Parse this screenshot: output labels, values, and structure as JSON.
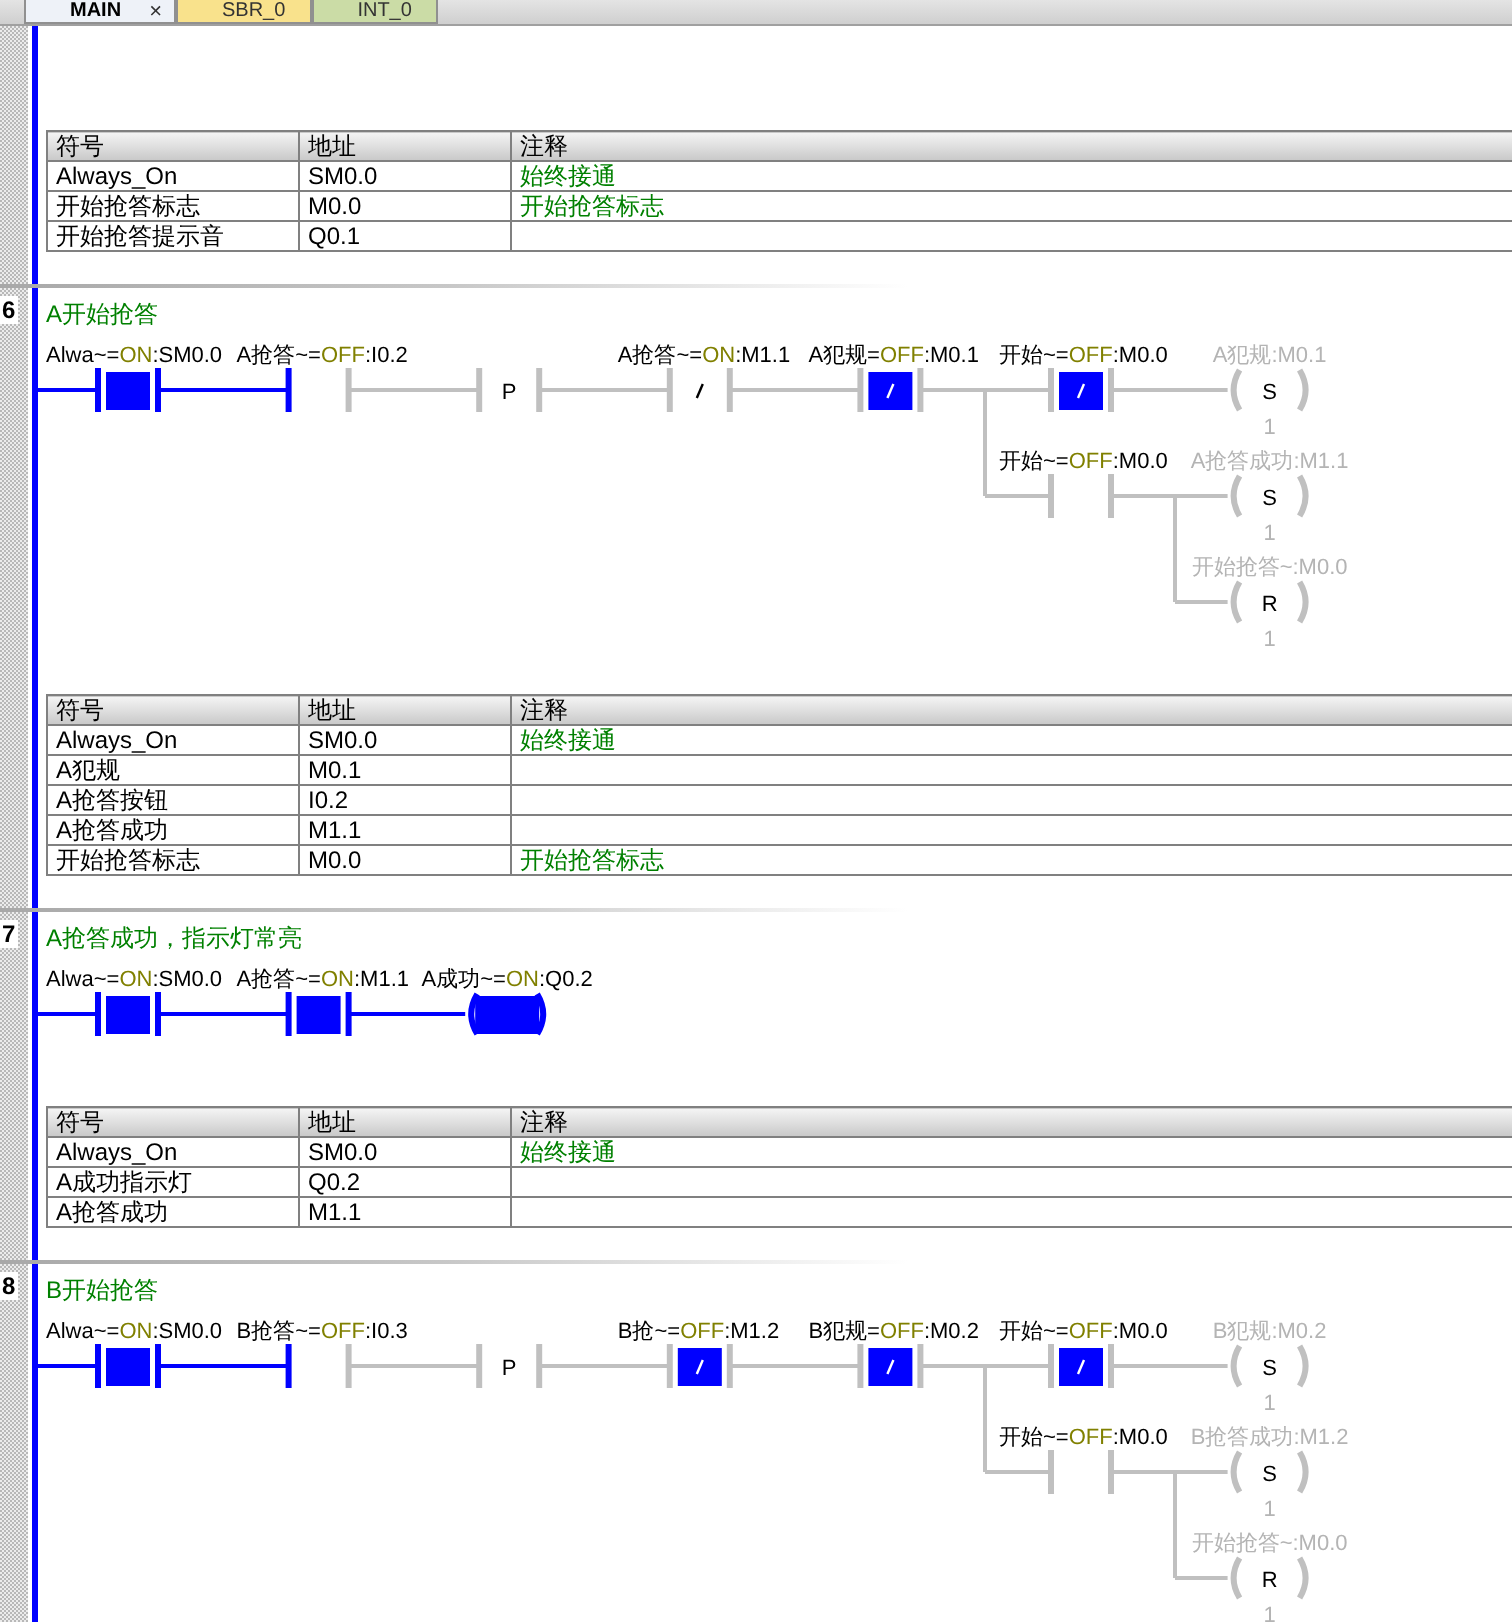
{
  "tabs": [
    {
      "label": "MAIN",
      "selected": true,
      "close": "×",
      "color": "#eef2f8"
    },
    {
      "label": "SBR_0",
      "selected": false,
      "color": "#f9e28c"
    },
    {
      "label": "INT_0",
      "selected": false,
      "color": "#cbdca6"
    }
  ],
  "networks": [
    {
      "table": {
        "columns": [
          "符号",
          "地址",
          "注释"
        ],
        "rows": [
          {
            "symbol": "Always_On",
            "address": "SM0.0",
            "comment": "始终接通"
          },
          {
            "symbol": "开始抢答标志",
            "address": "M0.0",
            "comment": "开始抢答标志"
          },
          {
            "symbol": "开始抢答提示音",
            "address": "Q0.1"
          }
        ]
      }
    },
    {
      "number": "6",
      "title": "A开始抢答",
      "rung": {
        "elements": [
          {
            "kind": "contact",
            "name": "Alwa~=",
            "value": "ON",
            "address": ":SM0.0",
            "closed": true
          },
          {
            "kind": "contact",
            "name": "A抢答~=",
            "value": "OFF",
            "address": ":I0.2",
            "closed": false
          },
          {
            "kind": "edge",
            "symbol": "P"
          },
          {
            "kind": "nc_contact",
            "name": "A抢答~=",
            "value": "ON",
            "address": ":M1.1",
            "closed": false
          },
          {
            "kind": "nc_contact",
            "name": "A犯规=",
            "value": "OFF",
            "address": ":M0.1",
            "closed": true
          }
        ],
        "branches": [
          {
            "elements": [
              {
                "kind": "nc_contact",
                "name": "开始~=",
                "value": "OFF",
                "address": ":M0.0",
                "closed": true
              }
            ],
            "outputs": [
              {
                "kind": "coil",
                "op": "S",
                "label": "A犯规:M0.1",
                "count": "1"
              }
            ]
          },
          {
            "elements": [
              {
                "kind": "contact",
                "name": "开始~=",
                "value": "OFF",
                "address": ":M0.0",
                "closed": false
              }
            ],
            "outputs": [
              {
                "kind": "coil",
                "op": "S",
                "label": "A抢答成功:M1.1",
                "count": "1"
              },
              {
                "kind": "coil",
                "op": "R",
                "label": "开始抢答~:M0.0",
                "count": "1"
              }
            ]
          }
        ]
      },
      "table": {
        "columns": [
          "符号",
          "地址",
          "注释"
        ],
        "rows": [
          {
            "symbol": "Always_On",
            "address": "SM0.0",
            "comment": "始终接通"
          },
          {
            "symbol": "A犯规",
            "address": "M0.1"
          },
          {
            "symbol": "A抢答按钮",
            "address": "I0.2"
          },
          {
            "symbol": "A抢答成功",
            "address": "M1.1"
          },
          {
            "symbol": "开始抢答标志",
            "address": "M0.0",
            "comment": "开始抢答标志"
          }
        ]
      }
    },
    {
      "number": "7",
      "title": "A抢答成功，指示灯常亮",
      "rung": {
        "elements": [
          {
            "kind": "contact",
            "name": "Alwa~=",
            "value": "ON",
            "address": ":SM0.0",
            "closed": true
          },
          {
            "kind": "contact",
            "name": "A抢答~=",
            "value": "ON",
            "address": ":M1.1",
            "closed": true
          }
        ],
        "outputs": [
          {
            "kind": "coil",
            "name": "A成功~=",
            "value": "ON",
            "address": ":Q0.2"
          }
        ]
      },
      "table": {
        "columns": [
          "符号",
          "地址",
          "注释"
        ],
        "rows": [
          {
            "symbol": "Always_On",
            "address": "SM0.0",
            "comment": "始终接通"
          },
          {
            "symbol": "A成功指示灯",
            "address": "Q0.2"
          },
          {
            "symbol": "A抢答成功",
            "address": "M1.1"
          }
        ]
      }
    },
    {
      "number": "8",
      "title": "B开始抢答",
      "rung": {
        "elements": [
          {
            "kind": "contact",
            "name": "Alwa~=",
            "value": "ON",
            "address": ":SM0.0",
            "closed": true
          },
          {
            "kind": "contact",
            "name": "B抢答~=",
            "value": "OFF",
            "address": ":I0.3",
            "closed": false
          },
          {
            "kind": "edge",
            "symbol": "P"
          },
          {
            "kind": "nc_contact",
            "name": "B抢~=",
            "value": "OFF",
            "address": ":M1.2",
            "closed": true
          },
          {
            "kind": "nc_contact",
            "name": "B犯规=",
            "value": "OFF",
            "address": ":M0.2",
            "closed": true
          }
        ],
        "branches": [
          {
            "elements": [
              {
                "kind": "nc_contact",
                "name": "开始~=",
                "value": "OFF",
                "address": ":M0.0",
                "closed": true
              }
            ],
            "outputs": [
              {
                "kind": "coil",
                "op": "S",
                "label": "B犯规:M0.2",
                "count": "1"
              }
            ]
          },
          {
            "elements": [
              {
                "kind": "contact",
                "name": "开始~=",
                "value": "OFF",
                "address": ":M0.0",
                "closed": false
              }
            ],
            "outputs": [
              {
                "kind": "coil",
                "op": "S",
                "label": "B抢答成功:M1.2",
                "count": "1"
              },
              {
                "kind": "coil",
                "op": "R",
                "label": "开始抢答~:M0.0",
                "count": "1"
              }
            ]
          }
        ]
      }
    }
  ]
}
